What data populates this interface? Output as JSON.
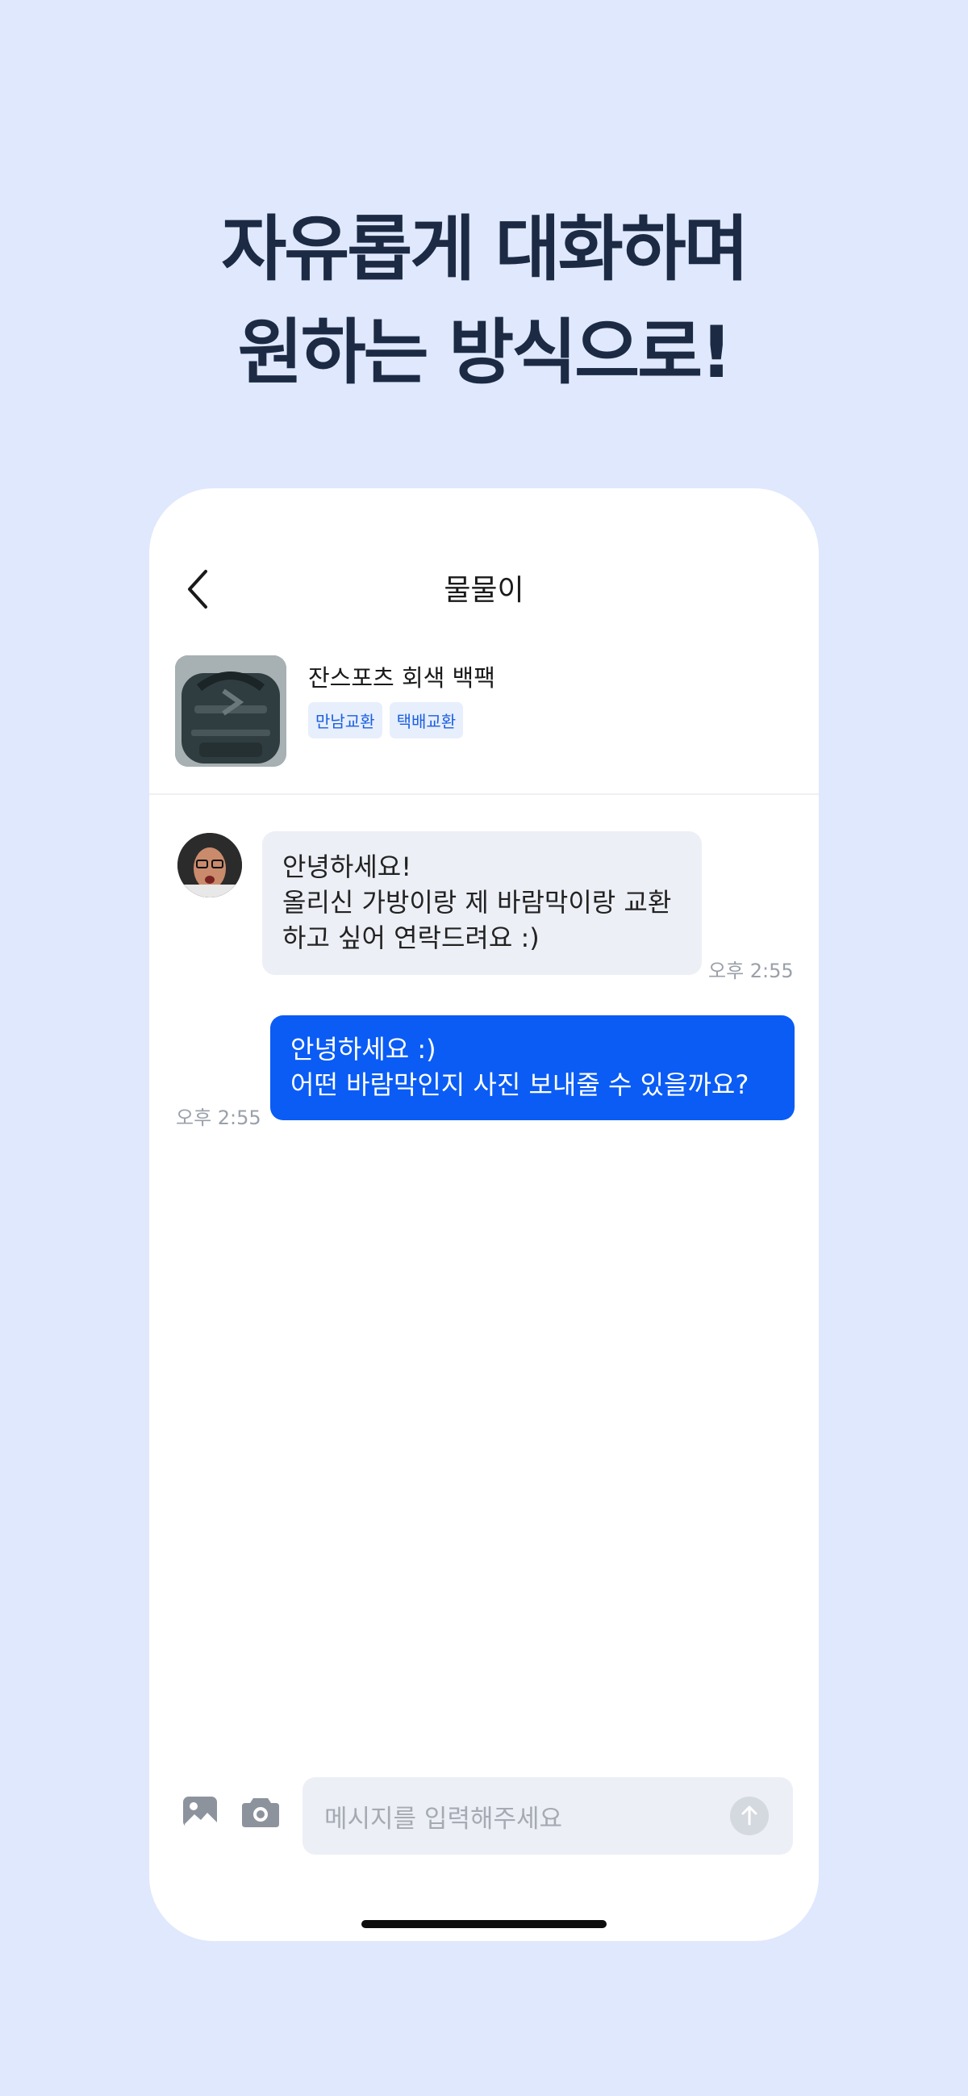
{
  "headline": {
    "line1": "자유롭게 대화하며",
    "line2": "원하는 방식으로!"
  },
  "chat": {
    "title": "물물이",
    "product": {
      "name": "잔스포츠 회색 백팩",
      "tags": [
        "만남교환",
        "택배교환"
      ]
    },
    "messages": [
      {
        "from": "other",
        "lines": [
          "안녕하세요!",
          "올리신 가방이랑 제 바람막이랑 교환",
          "하고 싶어 연락드려요 :)"
        ],
        "time": "오후 2:55"
      },
      {
        "from": "me",
        "lines": [
          "안녕하세요 :)",
          "어떤 바람막인지 사진 보내줄 수 있을까요?"
        ],
        "time": "오후 2:55"
      }
    ],
    "input": {
      "placeholder": "메시지를 입력해주세요"
    },
    "icons": {
      "back": "chevron-left-icon",
      "gallery": "image-icon",
      "camera": "camera-icon",
      "send": "arrow-up-icon"
    }
  },
  "colors": {
    "background": "#dfe8fd",
    "accent": "#0a5cf5",
    "headline": "#1c2a44",
    "tag_text": "#1a5fe0"
  }
}
